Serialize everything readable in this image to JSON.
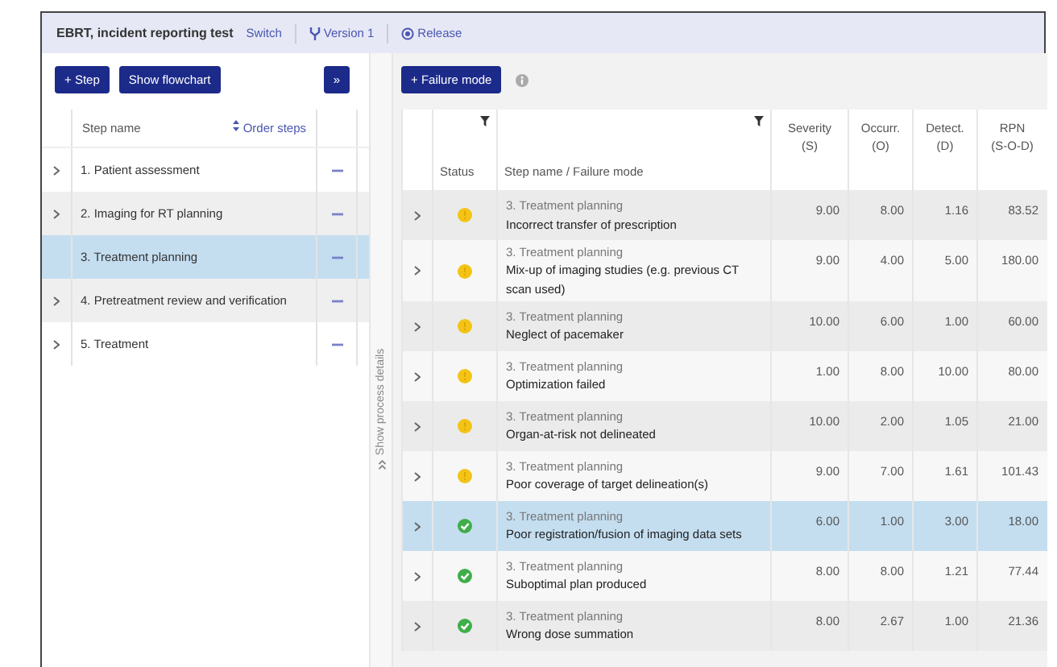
{
  "header": {
    "title": "EBRT, incident reporting test",
    "switch": "Switch",
    "version": "Version 1",
    "release": "Release"
  },
  "left_panel": {
    "buttons": [
      "+ Step",
      "Show flowchart"
    ],
    "collapse": "»",
    "columns": {
      "step_name": "Step name",
      "order": "Order steps"
    },
    "steps": [
      {
        "label": "1. Patient assessment",
        "expandable": true,
        "selected": false
      },
      {
        "label": "2. Imaging for RT planning",
        "expandable": true,
        "selected": false
      },
      {
        "label": "3. Treatment planning",
        "expandable": false,
        "selected": true
      },
      {
        "label": "4. Pretreatment review and verification",
        "expandable": true,
        "selected": false
      },
      {
        "label": "5. Treatment",
        "expandable": true,
        "selected": false
      }
    ]
  },
  "side_strip": {
    "label": "Show process details"
  },
  "right_panel": {
    "add_button": "+ Failure mode",
    "columns": [
      {
        "label": "Status",
        "filter": true
      },
      {
        "label": "Step name / Failure mode",
        "filter": true
      },
      {
        "label": "Severity",
        "abbr": "(S)",
        "filter": false
      },
      {
        "label": "Occurr.",
        "abbr": "(O)",
        "filter": false
      },
      {
        "label": "Detect.",
        "abbr": "(D)",
        "filter": false
      },
      {
        "label": "RPN",
        "abbr": "(S-O-D)",
        "filter": false
      }
    ],
    "rows": [
      {
        "kind": "warning",
        "step": "3. Treatment planning",
        "failure_mode": "Incorrect transfer of prescription",
        "severity": "9.00",
        "occurrence": "8.00",
        "detection": "1.16",
        "rpn": "83.52",
        "selected": false
      },
      {
        "kind": "warning",
        "step": "3. Treatment planning",
        "failure_mode": "Mix-up of imaging studies (e.g. previous CT scan used)",
        "severity": "9.00",
        "occurrence": "4.00",
        "detection": "5.00",
        "rpn": "180.00",
        "selected": false
      },
      {
        "kind": "warning",
        "step": "3. Treatment planning",
        "failure_mode": "Neglect of pacemaker",
        "severity": "10.00",
        "occurrence": "6.00",
        "detection": "1.00",
        "rpn": "60.00",
        "selected": false
      },
      {
        "kind": "warning",
        "step": "3. Treatment planning",
        "failure_mode": "Optimization failed",
        "severity": "1.00",
        "occurrence": "8.00",
        "detection": "10.00",
        "rpn": "80.00",
        "selected": false
      },
      {
        "kind": "warning",
        "step": "3. Treatment planning",
        "failure_mode": "Organ-at-risk not delineated",
        "severity": "10.00",
        "occurrence": "2.00",
        "detection": "1.05",
        "rpn": "21.00",
        "selected": false
      },
      {
        "kind": "warning",
        "step": "3. Treatment planning",
        "failure_mode": "Poor coverage of target delineation(s)",
        "severity": "9.00",
        "occurrence": "7.00",
        "detection": "1.61",
        "rpn": "101.43",
        "selected": false
      },
      {
        "kind": "done",
        "step": "3. Treatment planning",
        "failure_mode": "Poor registration/fusion of imaging data sets",
        "severity": "6.00",
        "occurrence": "1.00",
        "detection": "3.00",
        "rpn": "18.00",
        "selected": true
      },
      {
        "kind": "done",
        "step": "3. Treatment planning",
        "failure_mode": "Suboptimal plan produced",
        "severity": "8.00",
        "occurrence": "8.00",
        "detection": "1.21",
        "rpn": "77.44",
        "selected": false
      },
      {
        "kind": "done",
        "step": "3. Treatment planning",
        "failure_mode": "Wrong dose summation",
        "severity": "8.00",
        "occurrence": "2.67",
        "detection": "1.00",
        "rpn": "21.36",
        "selected": false
      }
    ]
  }
}
